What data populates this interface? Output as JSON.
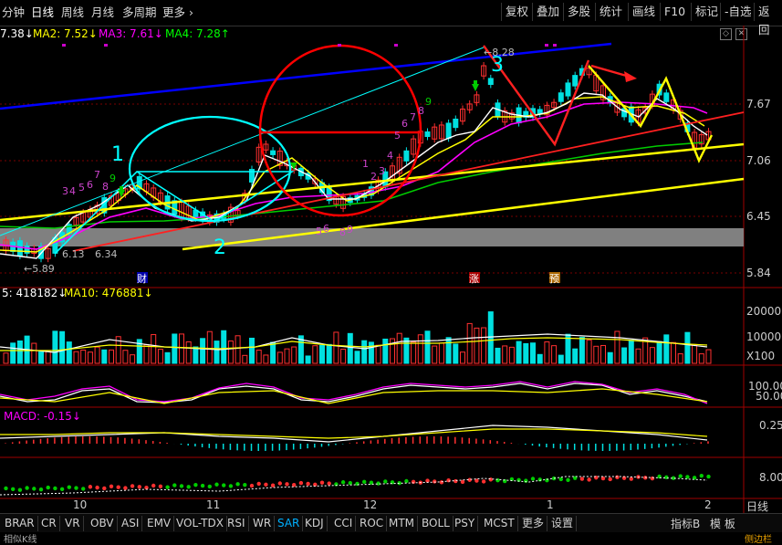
{
  "toolbar": {
    "items": [
      "分钟",
      "日线",
      "周线",
      "月线",
      "多周期",
      "更多 ›"
    ],
    "active": "日线",
    "buttons": [
      "复权",
      "叠加",
      "多股",
      "统计",
      "画线",
      "F10",
      "标记",
      "-自选",
      "返回"
    ]
  },
  "ma": {
    "ma1_value": "7.38↓",
    "ma2": "MA2: 7.52↓",
    "ma3": "MA3: 7.61↓",
    "ma4": "MA4: 7.28↑",
    "colors": {
      "ma1": "#ffffff",
      "ma2": "#ffff00",
      "ma3": "#ff00ff",
      "ma4": "#00ff00"
    }
  },
  "price_axis": [
    "7.67",
    "7.06",
    "6.45",
    "5.84"
  ],
  "annotations": {
    "wave_1": "1",
    "wave_2": "2",
    "wave_3": "3",
    "high_label": "8.28",
    "low_label": "5.89",
    "label_613": "6.13",
    "label_634": "6.34",
    "marker_cai": "财",
    "marker_zhang": "涨",
    "marker_yu": "预"
  },
  "volume": {
    "label_vol5": "5: 418182↓",
    "label_ma10": "MA10: 476881↓",
    "axis": [
      "20000",
      "10000",
      "X100"
    ]
  },
  "osc": {
    "axis": [
      "100.00",
      "50.00"
    ]
  },
  "macd": {
    "label": "MACD: -0.15↓",
    "axis": [
      "0.25"
    ]
  },
  "sar": {
    "axis": [
      "8.00"
    ]
  },
  "date_axis": [
    "10",
    "11",
    "12",
    "1",
    "2"
  ],
  "bottom_tabs": [
    "BRAR",
    "CR",
    "VR",
    "OBV",
    "ASI",
    "EMV",
    "VOL-TDX",
    "RSI",
    "WR",
    "SAR",
    "KDJ",
    "CCI",
    "ROC",
    "MTM",
    "BOLL",
    "PSY",
    "MCST",
    "更多",
    "设置"
  ],
  "active_tab": "SAR",
  "side_buttons": {
    "day_line": "日线",
    "indicator": "指标B",
    "template": "模 板",
    "compact": "侧边栏"
  },
  "footer_text": "相似K线"
}
